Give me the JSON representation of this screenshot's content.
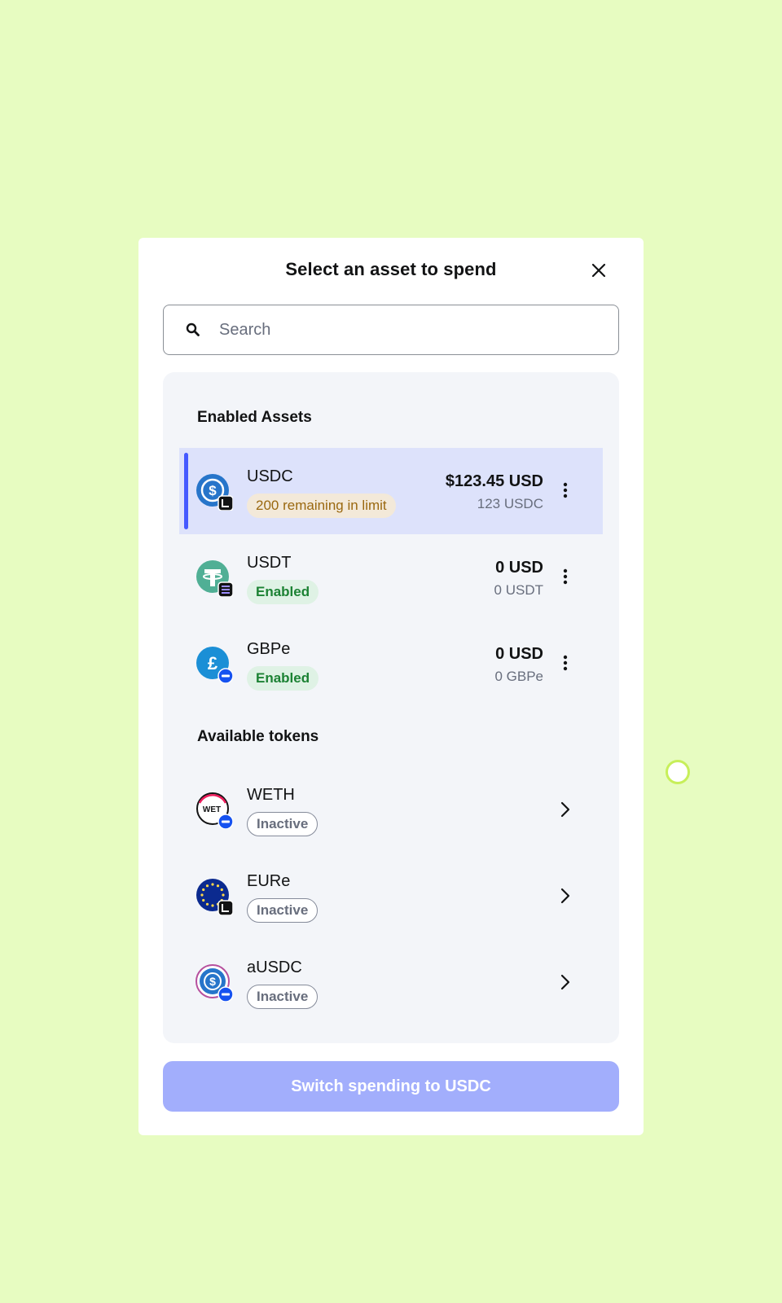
{
  "modal": {
    "title": "Select an asset to spend",
    "close_icon": "close-icon"
  },
  "search": {
    "placeholder": "Search",
    "value": "",
    "icon": "search-icon"
  },
  "enabled_assets": {
    "title": "Enabled Assets",
    "items": [
      {
        "name": "USDC",
        "badge": "200 remaining in limit",
        "fiat": "$123.45 USD",
        "crypto": "123 USDC",
        "icon": "usdc-token-icon",
        "network_icon": "linea-network-icon",
        "selected": true
      },
      {
        "name": "USDT",
        "badge": "Enabled",
        "fiat": "0 USD",
        "crypto": "0 USDT",
        "icon": "usdt-token-icon",
        "network_icon": "solana-network-icon",
        "selected": false
      },
      {
        "name": "GBPe",
        "badge": "Enabled",
        "fiat": "0 USD",
        "crypto": "0 GBPe",
        "icon": "gbpe-token-icon",
        "network_icon": "base-network-icon",
        "selected": false
      }
    ]
  },
  "available_tokens": {
    "title": "Available tokens",
    "items": [
      {
        "name": "WETH",
        "badge": "Inactive",
        "icon": "weth-token-icon",
        "network_icon": "base-network-icon"
      },
      {
        "name": "EURe",
        "badge": "Inactive",
        "icon": "eure-token-icon",
        "network_icon": "linea-network-icon"
      },
      {
        "name": "aUSDC",
        "badge": "Inactive",
        "icon": "ausdc-token-icon",
        "network_icon": "base-network-icon"
      }
    ]
  },
  "footer": {
    "switch_label": "Switch spending to USDC"
  },
  "colors": {
    "background": "#e7fcc1",
    "accent": "#4459ff",
    "button_disabled": "#a2aefc",
    "selected_row": "#dde2fb"
  }
}
